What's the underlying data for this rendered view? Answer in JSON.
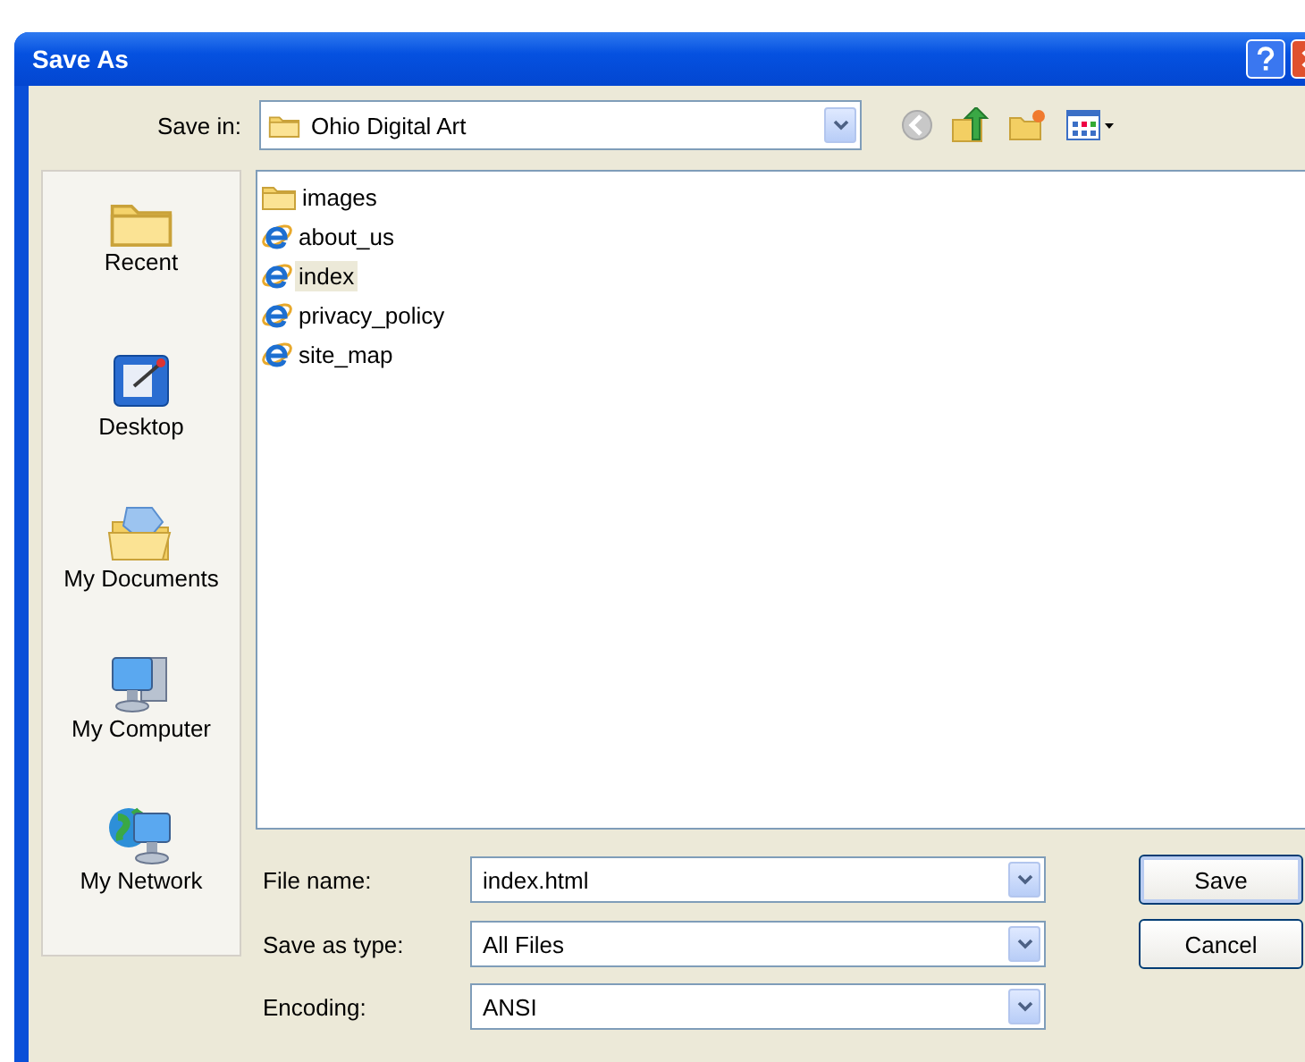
{
  "window": {
    "title": "Save As"
  },
  "save_in": {
    "label": "Save in:",
    "value": "Ohio Digital Art"
  },
  "places": [
    {
      "label": "Recent",
      "kind": "recent"
    },
    {
      "label": "Desktop",
      "kind": "desktop"
    },
    {
      "label": "My Documents",
      "kind": "documents"
    },
    {
      "label": "My Computer",
      "kind": "computer"
    },
    {
      "label": "My Network",
      "kind": "network"
    }
  ],
  "files": [
    {
      "name": "images",
      "kind": "folder",
      "selected": false
    },
    {
      "name": "about_us",
      "kind": "page",
      "selected": false
    },
    {
      "name": "index",
      "kind": "page",
      "selected": true
    },
    {
      "name": "privacy_policy",
      "kind": "page",
      "selected": false
    },
    {
      "name": "site_map",
      "kind": "page",
      "selected": false
    }
  ],
  "fields": [
    {
      "label": "File name:",
      "value": "index.html"
    },
    {
      "label": "Save as type:",
      "value": "All Files"
    },
    {
      "label": "Encoding:",
      "value": "ANSI"
    }
  ],
  "buttons": [
    {
      "label": "Save",
      "default": true
    },
    {
      "label": "Cancel",
      "default": false
    }
  ]
}
